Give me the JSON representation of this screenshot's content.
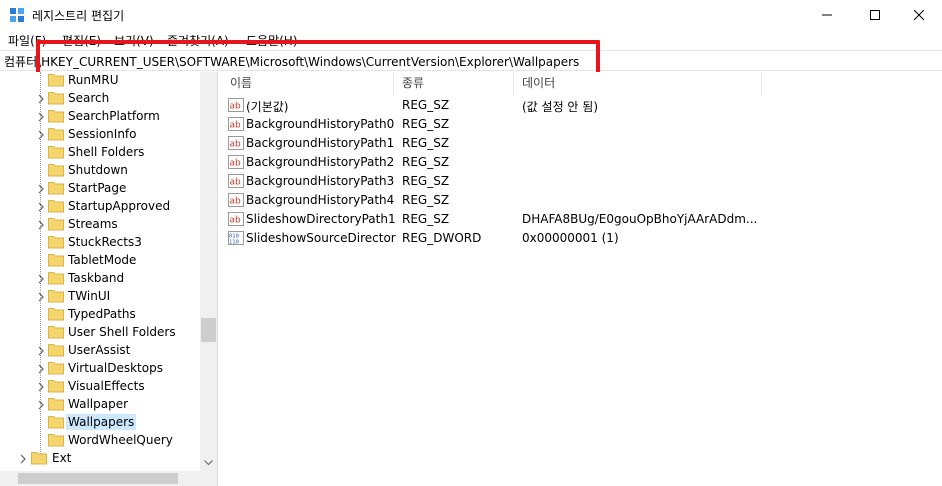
{
  "window": {
    "title": "레지스트리 편집기",
    "icon": "regedit-icon",
    "minimize": "—",
    "maximize": "☐",
    "close": "✕"
  },
  "menu": {
    "items": [
      "파일(F)",
      "편집(E)",
      "보기(V)",
      "즐겨찾기(A)",
      "도움말(H)"
    ]
  },
  "address": {
    "value": "컴퓨터\\HKEY_CURRENT_USER\\SOFTWARE\\Microsoft\\Windows\\CurrentVersion\\Explorer\\Wallpapers",
    "highlight_color": "#e8141c"
  },
  "tree": {
    "items": [
      {
        "label": "RunMRU",
        "expandable": false
      },
      {
        "label": "Search",
        "expandable": true
      },
      {
        "label": "SearchPlatform",
        "expandable": true
      },
      {
        "label": "SessionInfo",
        "expandable": true
      },
      {
        "label": "Shell Folders",
        "expandable": false
      },
      {
        "label": "Shutdown",
        "expandable": false
      },
      {
        "label": "StartPage",
        "expandable": true
      },
      {
        "label": "StartupApproved",
        "expandable": true
      },
      {
        "label": "Streams",
        "expandable": true
      },
      {
        "label": "StuckRects3",
        "expandable": false
      },
      {
        "label": "TabletMode",
        "expandable": false
      },
      {
        "label": "Taskband",
        "expandable": true
      },
      {
        "label": "TWinUI",
        "expandable": true
      },
      {
        "label": "TypedPaths",
        "expandable": false
      },
      {
        "label": "User Shell Folders",
        "expandable": false
      },
      {
        "label": "UserAssist",
        "expandable": true
      },
      {
        "label": "VirtualDesktops",
        "expandable": true
      },
      {
        "label": "VisualEffects",
        "expandable": true
      },
      {
        "label": "Wallpaper",
        "expandable": true
      },
      {
        "label": "Wallpapers",
        "expandable": false,
        "selected": true
      },
      {
        "label": "WordWheelQuery",
        "expandable": false
      }
    ],
    "parent_item": {
      "label": "Ext",
      "expandable": true
    },
    "selected_color": "#cce8ff"
  },
  "list": {
    "headers": {
      "name": "이름",
      "type": "종류",
      "data": "데이터"
    },
    "rows": [
      {
        "icon": "string-value-icon",
        "name": "(기본값)",
        "type": "REG_SZ",
        "data": "(값 설정 안 됨)"
      },
      {
        "icon": "string-value-icon",
        "name": "BackgroundHistoryPath0",
        "type": "REG_SZ",
        "data": ""
      },
      {
        "icon": "string-value-icon",
        "name": "BackgroundHistoryPath1",
        "type": "REG_SZ",
        "data": ""
      },
      {
        "icon": "string-value-icon",
        "name": "BackgroundHistoryPath2",
        "type": "REG_SZ",
        "data": ""
      },
      {
        "icon": "string-value-icon",
        "name": "BackgroundHistoryPath3",
        "type": "REG_SZ",
        "data": ""
      },
      {
        "icon": "string-value-icon",
        "name": "BackgroundHistoryPath4",
        "type": "REG_SZ",
        "data": ""
      },
      {
        "icon": "string-value-icon",
        "name": "SlideshowDirectoryPath1",
        "type": "REG_SZ",
        "data": "DHAFA8BUg/E0gouOpBhoYjAArADdm..."
      },
      {
        "icon": "dword-value-icon",
        "name": "SlideshowSourceDirectori...",
        "type": "REG_DWORD",
        "data": "0x00000001 (1)"
      }
    ]
  }
}
